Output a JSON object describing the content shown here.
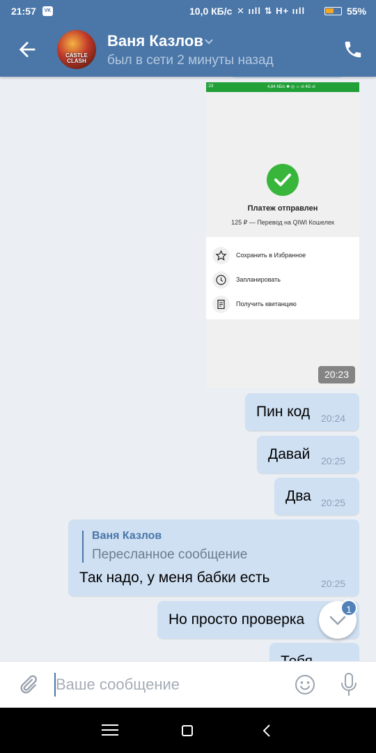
{
  "status_bar": {
    "time": "21:57",
    "vk_badge": "VK",
    "speed": "10,0 КБ/с",
    "signal_icons": "✕ ııll ⇅ H+ ııll",
    "battery_fraction": 0.55,
    "battery_label": "55%"
  },
  "header": {
    "contact_name": "Ваня Казлов",
    "last_seen": "был в сети 2 минуты назад",
    "avatar_text": "CASTLE CLASH"
  },
  "messages": {
    "image": {
      "time": "20:23",
      "screenshot": {
        "status_left": ":23",
        "status_right": "4,84 КБ/с ✱ ◎ ☼ ııl 4G ııl",
        "title": "Платеж отправлен",
        "subtitle": "125 ₽ — Перевод на QIWI Кошелек",
        "actions": [
          "Сохранить в Избранное",
          "Запланировать",
          "Получить квитанцию"
        ]
      }
    },
    "m1": {
      "text": "Пин код",
      "time": "20:24"
    },
    "m2": {
      "text": "Давай",
      "time": "20:25"
    },
    "m3": {
      "text": "Два",
      "time": "20:25"
    },
    "m4": {
      "forward_name": "Ваня Казлов",
      "forward_label": "Пересланное сообщение",
      "text": "Так надо, у меня бабки есть",
      "time": "20:25"
    },
    "m5": {
      "text": "Но просто проверка"
    },
    "m6": {
      "text": "Тебя"
    }
  },
  "scroll_down": {
    "badge": "1"
  },
  "composer": {
    "placeholder": "Ваше сообщение",
    "value": ""
  },
  "colors": {
    "brand": "#4a76a8",
    "bubble": "#cfe0f3",
    "background": "#ebeff4",
    "success": "#38b63b"
  }
}
